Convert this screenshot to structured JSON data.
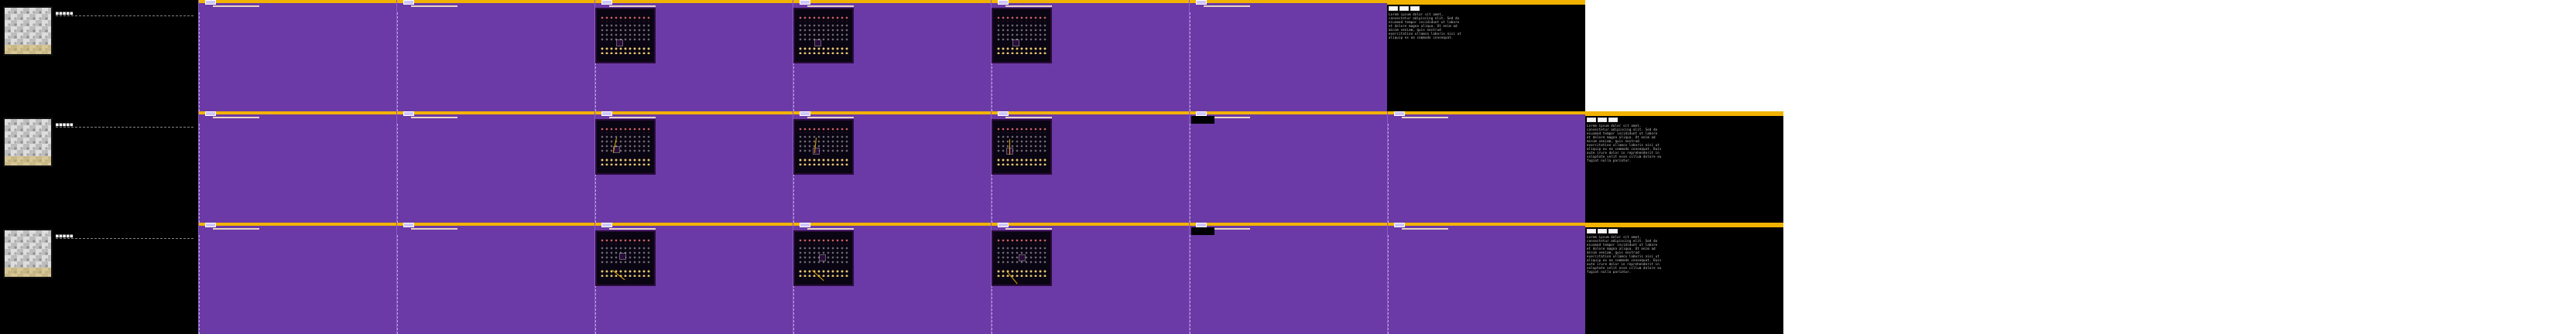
{
  "rows": [
    {
      "board_label": "■■■■■",
      "info_text": "Lorem ipsum dolor sit amet, consectetur adipiscing elit. Sed do eiusmod tempor incididunt ut labore et dolore magna aliqua. Ut enim ad minim veniam, quis nostrud exercitation ullamco laboris nisi ut aliquip ex ea commodo consequat."
    },
    {
      "board_label": "■■■■■",
      "info_text": "Lorem ipsum dolor sit amet, consectetur adipiscing elit. Sed do eiusmod tempor incididunt ut labore et dolore magna aliqua. Ut enim ad minim veniam, quis nostrud exercitation ullamco laboris nisi ut aliquip ex ea commodo consequat. Duis aute irure dolor in reprehenderit in voluptate velit esse cillum dolore eu fugiat nulla pariatur."
    },
    {
      "board_label": "■■■■■",
      "info_text": "Lorem ipsum dolor sit amet, consectetur adipiscing elit. Sed do eiusmod tempor incididunt ut labore et dolore magna aliqua. Ut enim ad minim veniam, quis nostrud exercitation ullamco laboris nisi ut aliquip ex ea commodo consequat. Duis aute irure dolor in reprehenderit in voluptate velit esse cillum dolore eu fugiat nulla pariatur."
    }
  ],
  "ui": {
    "accent": "#f2b300",
    "purple": "#6b3aa6",
    "panel_black": "#000000"
  }
}
